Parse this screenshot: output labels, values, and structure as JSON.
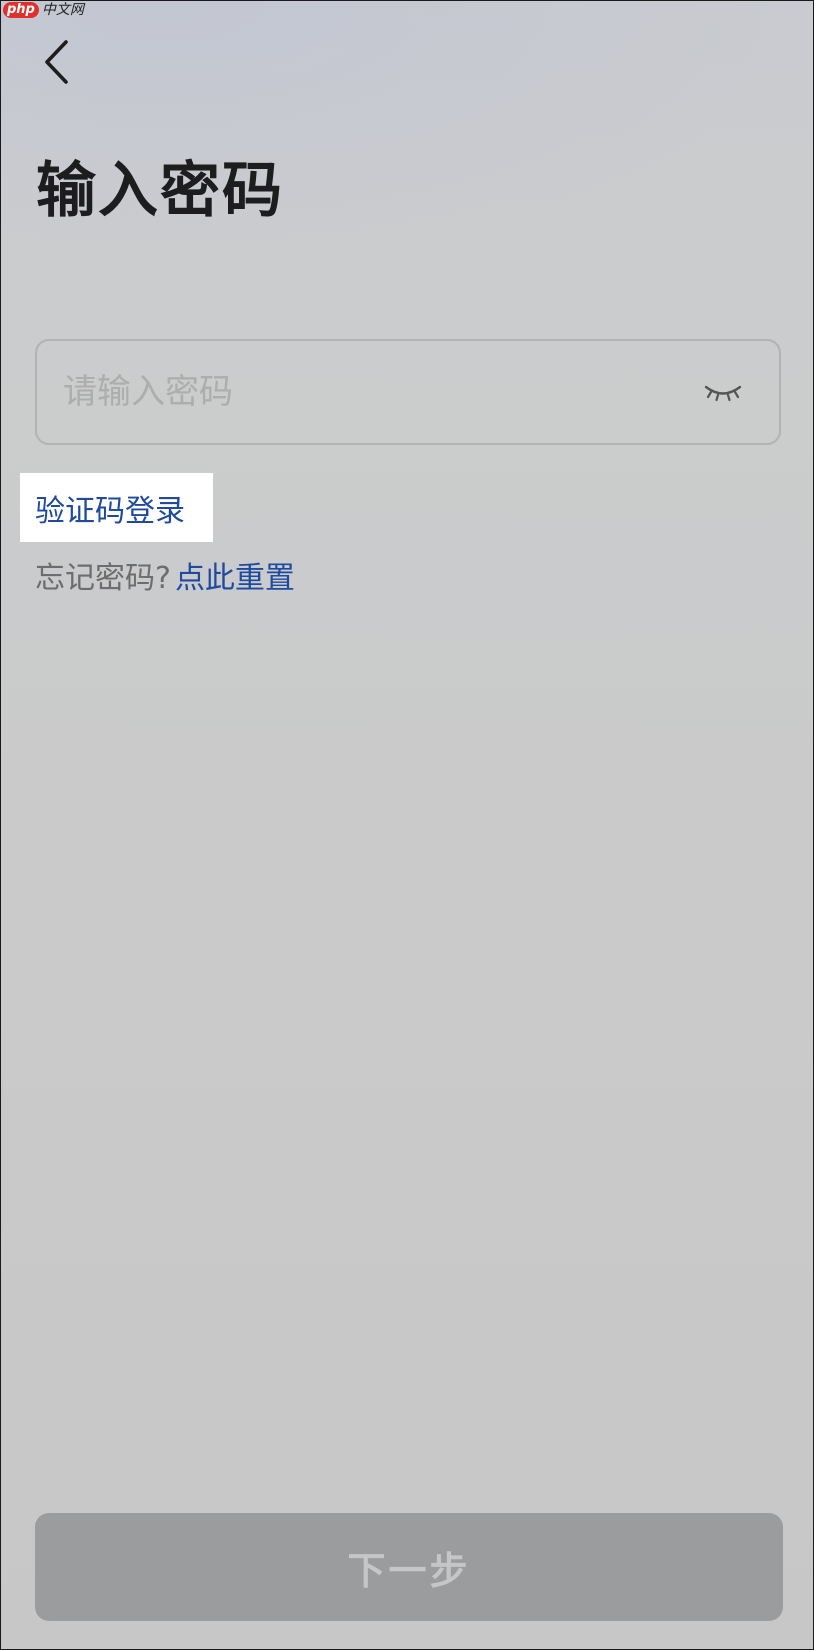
{
  "watermark": {
    "logo": "php",
    "site": "中文网"
  },
  "header": {
    "back_icon": "chevron-left-icon"
  },
  "page": {
    "title": "输入密码"
  },
  "password": {
    "value": "",
    "placeholder": "请输入密码",
    "toggle_icon": "eye-closed-icon"
  },
  "links": {
    "sms_login": "验证码登录",
    "forgot_prompt": "忘记密码?",
    "reset": "点此重置"
  },
  "footer": {
    "next_label": "下一步"
  },
  "colors": {
    "background": "#cacaca",
    "link": "#1f4aa0",
    "button_disabled": "#9b9c9e",
    "button_text_disabled": "#c5c6c8",
    "title": "#1d1d1f"
  }
}
